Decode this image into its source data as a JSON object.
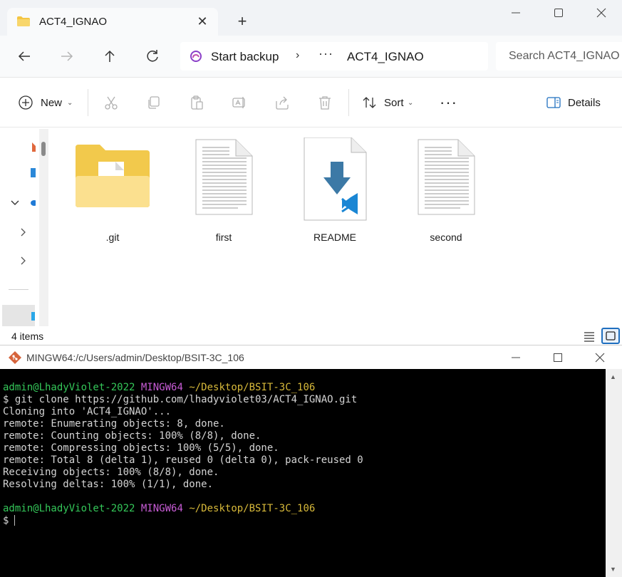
{
  "explorer": {
    "tab_title": "ACT4_IGNAO",
    "tab_close": "✕",
    "new_tab": "+",
    "breadcrumb": {
      "start": "Start backup",
      "separator": "›",
      "more": "···",
      "folder": "ACT4_IGNAO"
    },
    "search_placeholder": "Search ACT4_IGNAO",
    "toolbar": {
      "new_label": "New",
      "sort_label": "Sort",
      "more_label": "···",
      "details_label": "Details",
      "chevron": "⌄"
    },
    "files": [
      {
        "name": ".git",
        "type": "folder"
      },
      {
        "name": "first",
        "type": "text"
      },
      {
        "name": "README",
        "type": "markdown"
      },
      {
        "name": "second",
        "type": "text"
      }
    ],
    "status_count": "4 items",
    "colors": {
      "accent": "#1f6fbf",
      "folder": "#f8d66b"
    }
  },
  "terminal": {
    "title": "MINGW64:/c/Users/admin/Desktop/BSIT-3C_106",
    "prompt_user": "admin@LhadyViolet-2022",
    "prompt_env": "MINGW64",
    "prompt_path": "~/Desktop/BSIT-3C_106",
    "command": "$ git clone https://github.com/lhadyviolet03/ACT4_IGNAO.git",
    "output": [
      "Cloning into 'ACT4_IGNAO'...",
      "remote: Enumerating objects: 8, done.",
      "remote: Counting objects: 100% (8/8), done.",
      "remote: Compressing objects: 100% (5/5), done.",
      "remote: Total 8 (delta 1), reused 0 (delta 0), pack-reused 0",
      "Receiving objects: 100% (8/8), done.",
      "Resolving deltas: 100% (1/1), done."
    ],
    "prompt_symbol": "$",
    "colors": {
      "user": "#34c759",
      "env": "#c85cd6",
      "path": "#d7b93a"
    }
  }
}
